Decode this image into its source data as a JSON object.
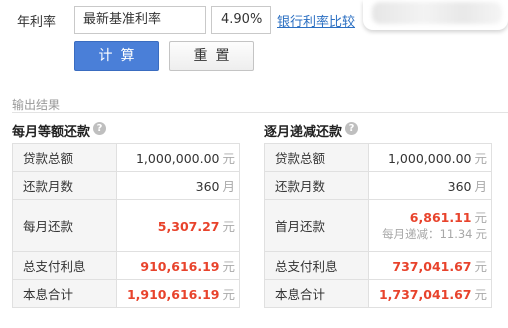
{
  "form": {
    "rate_label": "年利率",
    "rate_type_selected": "最新基准利率",
    "rate_value": "4.90%",
    "bank_link": "银行利率比较",
    "calc_button": "计算",
    "reset_button": "重置"
  },
  "output_label": "输出结果",
  "unit_yuan": "元",
  "unit_month": "月",
  "equal_payment": {
    "title": "每月等额还款",
    "rows": [
      {
        "label": "贷款总额",
        "value": "1,000,000.00",
        "unit": "元"
      },
      {
        "label": "还款月数",
        "value": "360",
        "unit": "月"
      },
      {
        "label": "每月还款",
        "value": "5,307.27",
        "unit": "元"
      },
      {
        "label": "总支付利息",
        "value": "910,616.19",
        "unit": "元"
      },
      {
        "label": "本息合计",
        "value": "1,910,616.19",
        "unit": "元"
      }
    ]
  },
  "decreasing_payment": {
    "title": "逐月递减还款",
    "rows": [
      {
        "label": "贷款总额",
        "value": "1,000,000.00",
        "unit": "元"
      },
      {
        "label": "还款月数",
        "value": "360",
        "unit": "月"
      },
      {
        "label": "首月还款",
        "value": "6,861.11",
        "unit": "元",
        "sub_label": "每月递减：",
        "sub_value": "11.34",
        "sub_unit": "元"
      },
      {
        "label": "总支付利息",
        "value": "737,041.67",
        "unit": "元"
      },
      {
        "label": "本息合计",
        "value": "1,737,041.67",
        "unit": "元"
      }
    ]
  },
  "colors": {
    "accent": "#4a7fd8",
    "highlight": "#e8432c",
    "link": "#2b6fc2"
  }
}
